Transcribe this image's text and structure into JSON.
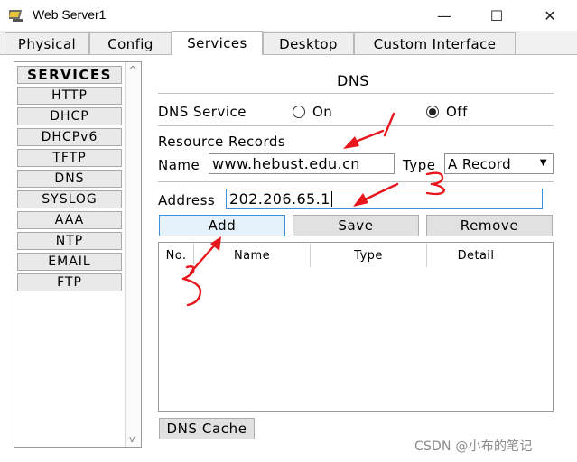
{
  "window": {
    "title": "Web Server1",
    "controls": {
      "minimize": "—",
      "maximize": "☐",
      "close": "✕"
    }
  },
  "tabs": [
    {
      "label": "Physical"
    },
    {
      "label": "Config"
    },
    {
      "label": "Services",
      "active": true
    },
    {
      "label": "Desktop"
    },
    {
      "label": "Custom Interface"
    }
  ],
  "services": {
    "header": "SERVICES",
    "items": [
      "HTTP",
      "DHCP",
      "DHCPv6",
      "TFTP",
      "DNS",
      "SYSLOG",
      "AAA",
      "NTP",
      "EMAIL",
      "FTP"
    ],
    "scroll_up": "^",
    "scroll_down": "v"
  },
  "dns": {
    "title": "DNS",
    "service_label": "DNS Service",
    "on_label": "On",
    "off_label": "Off",
    "selected": "Off",
    "records_label": "Resource Records",
    "name_label": "Name",
    "name_value": "www.hebust.edu.cn",
    "type_label": "Type",
    "type_value": "A Record",
    "address_label": "Address",
    "address_value": "202.206.65.1",
    "add_label": "Add",
    "save_label": "Save",
    "remove_label": "Remove",
    "columns": [
      "No.",
      "Name",
      "Type",
      "Detail"
    ],
    "cache_label": "DNS Cache"
  },
  "annotation_colors": {
    "arrow": "#e8161c"
  },
  "watermark": "CSDN @小布的笔记"
}
